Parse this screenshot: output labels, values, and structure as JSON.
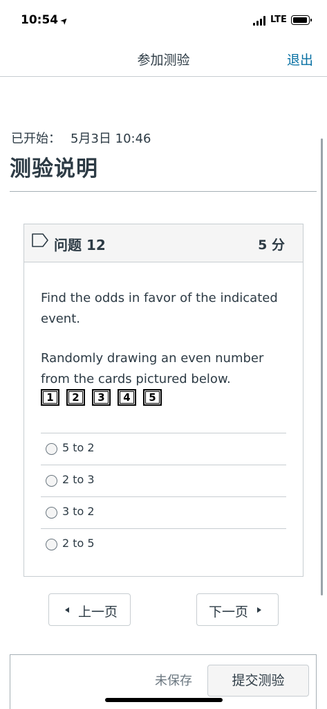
{
  "status_bar": {
    "time": "10:54",
    "network": "LTE"
  },
  "nav": {
    "title": "参加测验",
    "exit_label": "退出"
  },
  "header": {
    "started_label": "已开始：",
    "started_value": "5月3日 10:46",
    "title": "测验说明"
  },
  "question": {
    "title": "问题 12",
    "points": "5 分",
    "text_1": "Find the odds in favor of the indicated event.",
    "text_2": "Randomly drawing an even number from the cards pictured below.",
    "cards": [
      "1",
      "2",
      "3",
      "4",
      "5"
    ],
    "answers": [
      {
        "label": "5 to 2"
      },
      {
        "label": "2 to 3"
      },
      {
        "label": "3 to 2"
      },
      {
        "label": "2 to 5"
      }
    ]
  },
  "pager": {
    "prev_label": "上一页",
    "next_label": "下一页"
  },
  "footer": {
    "status": "未保存",
    "submit_label": "提交测验"
  },
  "colors": {
    "text": "#2d3b45",
    "link": "#0770a3",
    "border": "#c7cdd1"
  }
}
